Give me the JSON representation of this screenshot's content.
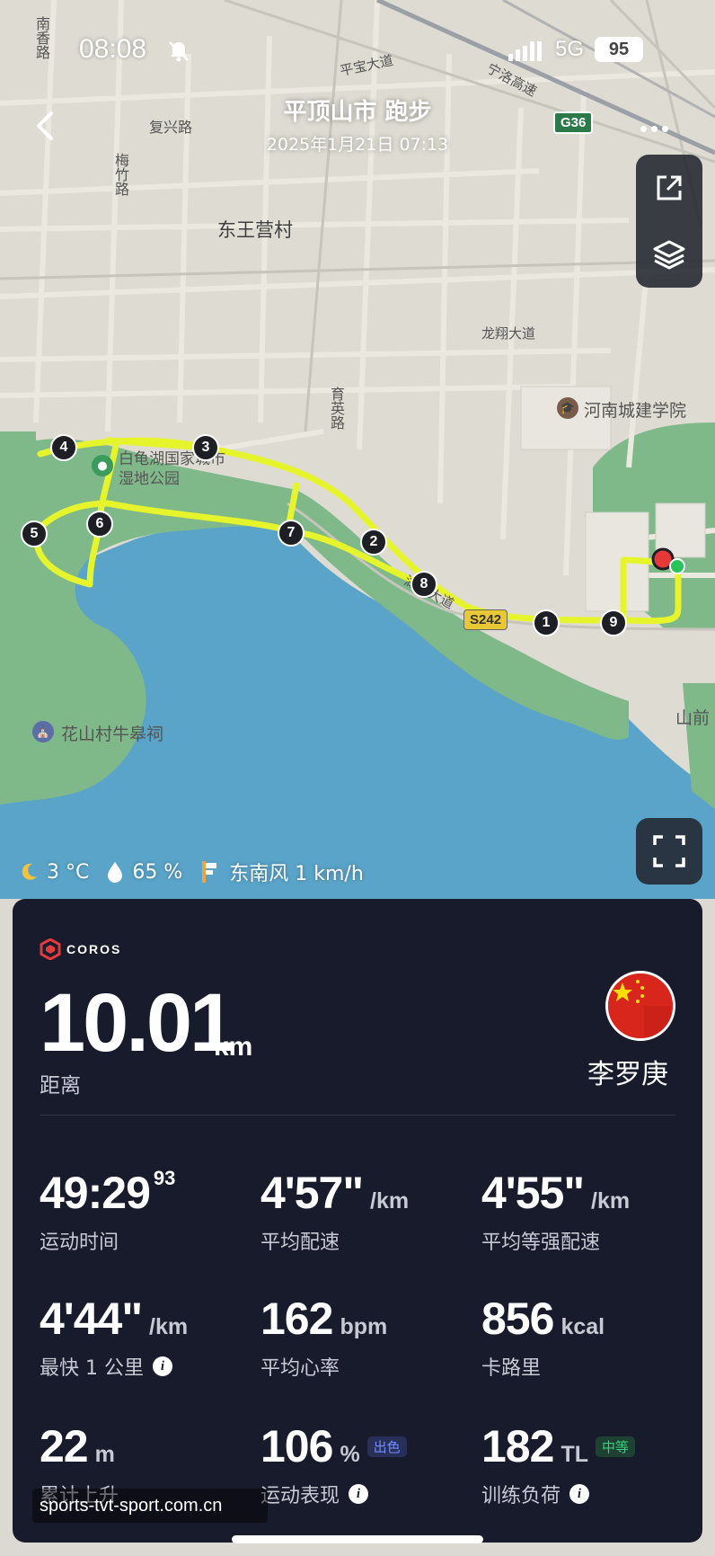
{
  "status_bar": {
    "time": "08:08",
    "network": "5G",
    "battery": "95"
  },
  "header": {
    "title": "平顶山市 跑步",
    "subtitle": "2025年1月21日 07:13"
  },
  "map": {
    "labels": {
      "nanxiang_road": "南香路",
      "fuxing_road": "复兴路",
      "meizhu_road": "梅竹路",
      "pingbao_avenue": "平宝大道",
      "ningluo_expressway": "宁洛高速",
      "dongwangying": "东王营村",
      "longxiang_avenue": "龙翔大道",
      "yuying_road": "育英路",
      "henan_urban_college": "河南城建学院",
      "baiguihu_park": "白龟湖国家城市湿地公园",
      "huashan_ancestral_hall": "花山村牛皋祠",
      "hubin_road": "湖滨大道",
      "shanqian": "山前"
    },
    "highway_g36": "G36",
    "highway_s242": "S242",
    "markers": [
      "1",
      "2",
      "3",
      "4",
      "5",
      "6",
      "7",
      "8",
      "9"
    ],
    "route_color": "#e6f52b",
    "water_color": "#5aa4c9",
    "green_color": "#7fb98a"
  },
  "weather": {
    "temperature": "3 °C",
    "humidity": "65 %",
    "wind": "东南风 1 km/h"
  },
  "card": {
    "brand": "COROS",
    "distance": {
      "value": "10.01",
      "unit": "km",
      "label": "距离"
    },
    "user_name": "李罗庚",
    "metrics": [
      {
        "value": "49:29",
        "sup": "93",
        "unit": "",
        "label": "运动时间"
      },
      {
        "value": "4'57\"",
        "unit": "/km",
        "label": "平均配速"
      },
      {
        "value": "4'55\"",
        "unit": "/km",
        "label": "平均等强配速"
      },
      {
        "value": "4'44\"",
        "unit": "/km",
        "label": "最快 1 公里"
      },
      {
        "value": "162",
        "unit": "bpm",
        "label": "平均心率"
      },
      {
        "value": "856",
        "unit": "kcal",
        "label": "卡路里"
      },
      {
        "value": "22",
        "unit": "m",
        "label": "累计上升"
      },
      {
        "value": "106",
        "unit": "%",
        "badge": "出色",
        "label": "运动表现"
      },
      {
        "value": "182",
        "unit": "TL",
        "badge": "中等",
        "label": "训练负荷"
      }
    ]
  },
  "watermark": "sports-tvt-sport.com.cn"
}
